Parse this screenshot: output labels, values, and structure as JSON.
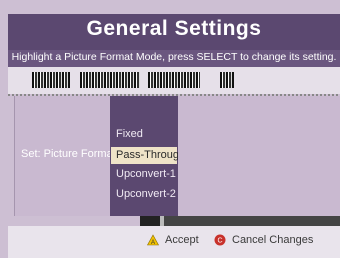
{
  "header": {
    "title": "General Settings"
  },
  "hint": "Highlight a Picture Format Mode, press SELECT to change its setting.",
  "setting": {
    "label": "Set: Picture Format",
    "options": [
      "Fixed",
      "Pass-Through",
      "Upconvert-1",
      "Upconvert-2"
    ],
    "selected": "Pass-Through"
  },
  "footer": {
    "accept_label": "Accept",
    "cancel_label": "Cancel Changes",
    "accept_icon": "triangle-a-icon",
    "cancel_icon": "circle-c-icon",
    "accept_color": "#f2c200",
    "cancel_color": "#c8312b"
  },
  "colors": {
    "title_bar": "#5b4870",
    "panel": "#c9b9d0",
    "selection": "#efe3c8"
  }
}
